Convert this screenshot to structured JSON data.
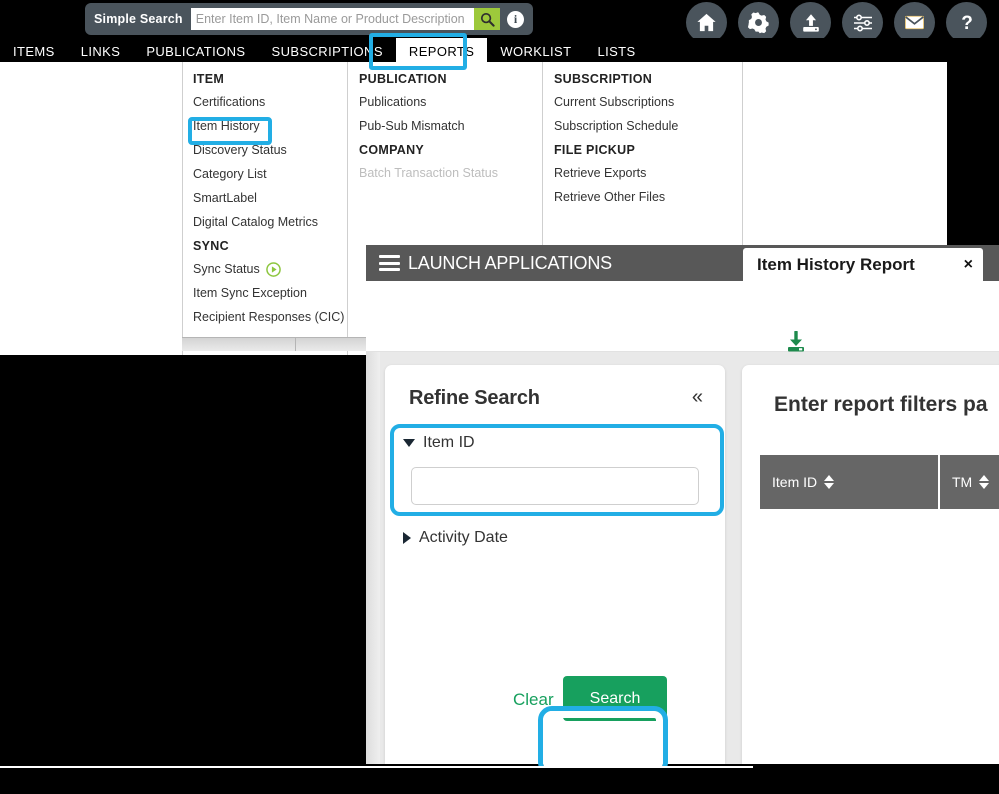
{
  "search": {
    "label": "Simple Search",
    "placeholder": "Enter Item ID, Item Name or Product Description",
    "value": "",
    "go_icon": "search-icon",
    "info_icon": "info-icon"
  },
  "top_icons": [
    {
      "name": "home-icon",
      "title": "Home"
    },
    {
      "name": "gear-icon",
      "title": "Settings"
    },
    {
      "name": "upload-icon",
      "title": "Upload"
    },
    {
      "name": "sliders-icon",
      "title": "Preferences"
    },
    {
      "name": "envelope-icon",
      "title": "Messages"
    },
    {
      "name": "help-icon",
      "title": "Help"
    }
  ],
  "nav": {
    "items": [
      {
        "label": "ITEMS",
        "active": false
      },
      {
        "label": "LINKS",
        "active": false
      },
      {
        "label": "PUBLICATIONS",
        "active": false
      },
      {
        "label": "SUBSCRIPTIONS",
        "active": false
      },
      {
        "label": "REPORTS",
        "active": true
      },
      {
        "label": "WORKLIST",
        "active": false
      },
      {
        "label": "LISTS",
        "active": false
      }
    ]
  },
  "dropdown": {
    "columns": [
      {
        "groups": [
          {
            "heading": "ITEM",
            "links": [
              {
                "label": "Certifications",
                "disabled": false,
                "icon": null
              },
              {
                "label": "Item History",
                "disabled": false,
                "icon": null,
                "highlighted": true
              },
              {
                "label": "Discovery Status",
                "disabled": false,
                "icon": null
              },
              {
                "label": "Category List",
                "disabled": false,
                "icon": null
              },
              {
                "label": "SmartLabel",
                "disabled": false,
                "icon": null
              },
              {
                "label": "Digital Catalog Metrics",
                "disabled": false,
                "icon": null
              }
            ]
          },
          {
            "heading": "SYNC",
            "links": [
              {
                "label": "Sync Status",
                "disabled": false,
                "icon": "play-icon"
              },
              {
                "label": "Item Sync Exception",
                "disabled": false,
                "icon": null
              },
              {
                "label": "Recipient Responses (CIC)",
                "disabled": false,
                "icon": null
              }
            ]
          }
        ]
      },
      {
        "groups": [
          {
            "heading": "PUBLICATION",
            "links": [
              {
                "label": "Publications",
                "disabled": false,
                "icon": null
              },
              {
                "label": "Pub-Sub Mismatch",
                "disabled": false,
                "icon": null
              }
            ]
          },
          {
            "heading": "COMPANY",
            "links": [
              {
                "label": "Batch Transaction Status",
                "disabled": true,
                "icon": null
              }
            ]
          }
        ]
      },
      {
        "groups": [
          {
            "heading": "SUBSCRIPTION",
            "links": [
              {
                "label": "Current Subscriptions",
                "disabled": false,
                "icon": null
              },
              {
                "label": "Subscription Schedule",
                "disabled": false,
                "icon": null
              }
            ]
          },
          {
            "heading": "FILE PICKUP",
            "links": [
              {
                "label": "Retrieve Exports",
                "disabled": false,
                "icon": null
              },
              {
                "label": "Retrieve Other Files",
                "disabled": false,
                "icon": null
              }
            ]
          }
        ]
      }
    ]
  },
  "app": {
    "header_title": "LAUNCH APPLICATIONS",
    "menu_icon": "hamburger-icon",
    "tab": {
      "label": "Item History Report",
      "close": "×"
    },
    "toolbar": {
      "download_label": "Download",
      "download_icon": "download-icon"
    },
    "refine": {
      "title": "Refine Search",
      "collapse_icon": "«",
      "facets": [
        {
          "label": "Item ID",
          "expanded": true,
          "value": "",
          "placeholder": ""
        },
        {
          "label": "Activity Date",
          "expanded": false
        }
      ],
      "clear_label": "Clear",
      "search_label": "Search"
    },
    "results": {
      "title": "Enter report filters pa",
      "columns": [
        {
          "label": "Item ID",
          "sortable": true
        },
        {
          "label": "TM",
          "sortable": true
        }
      ]
    }
  },
  "colors": {
    "highlight": "#22aee5",
    "green_accent": "#17a05e",
    "search_go": "#9dc93b",
    "header_gray": "#585858",
    "pill_gray": "#4a545c",
    "table_header": "#666666"
  }
}
